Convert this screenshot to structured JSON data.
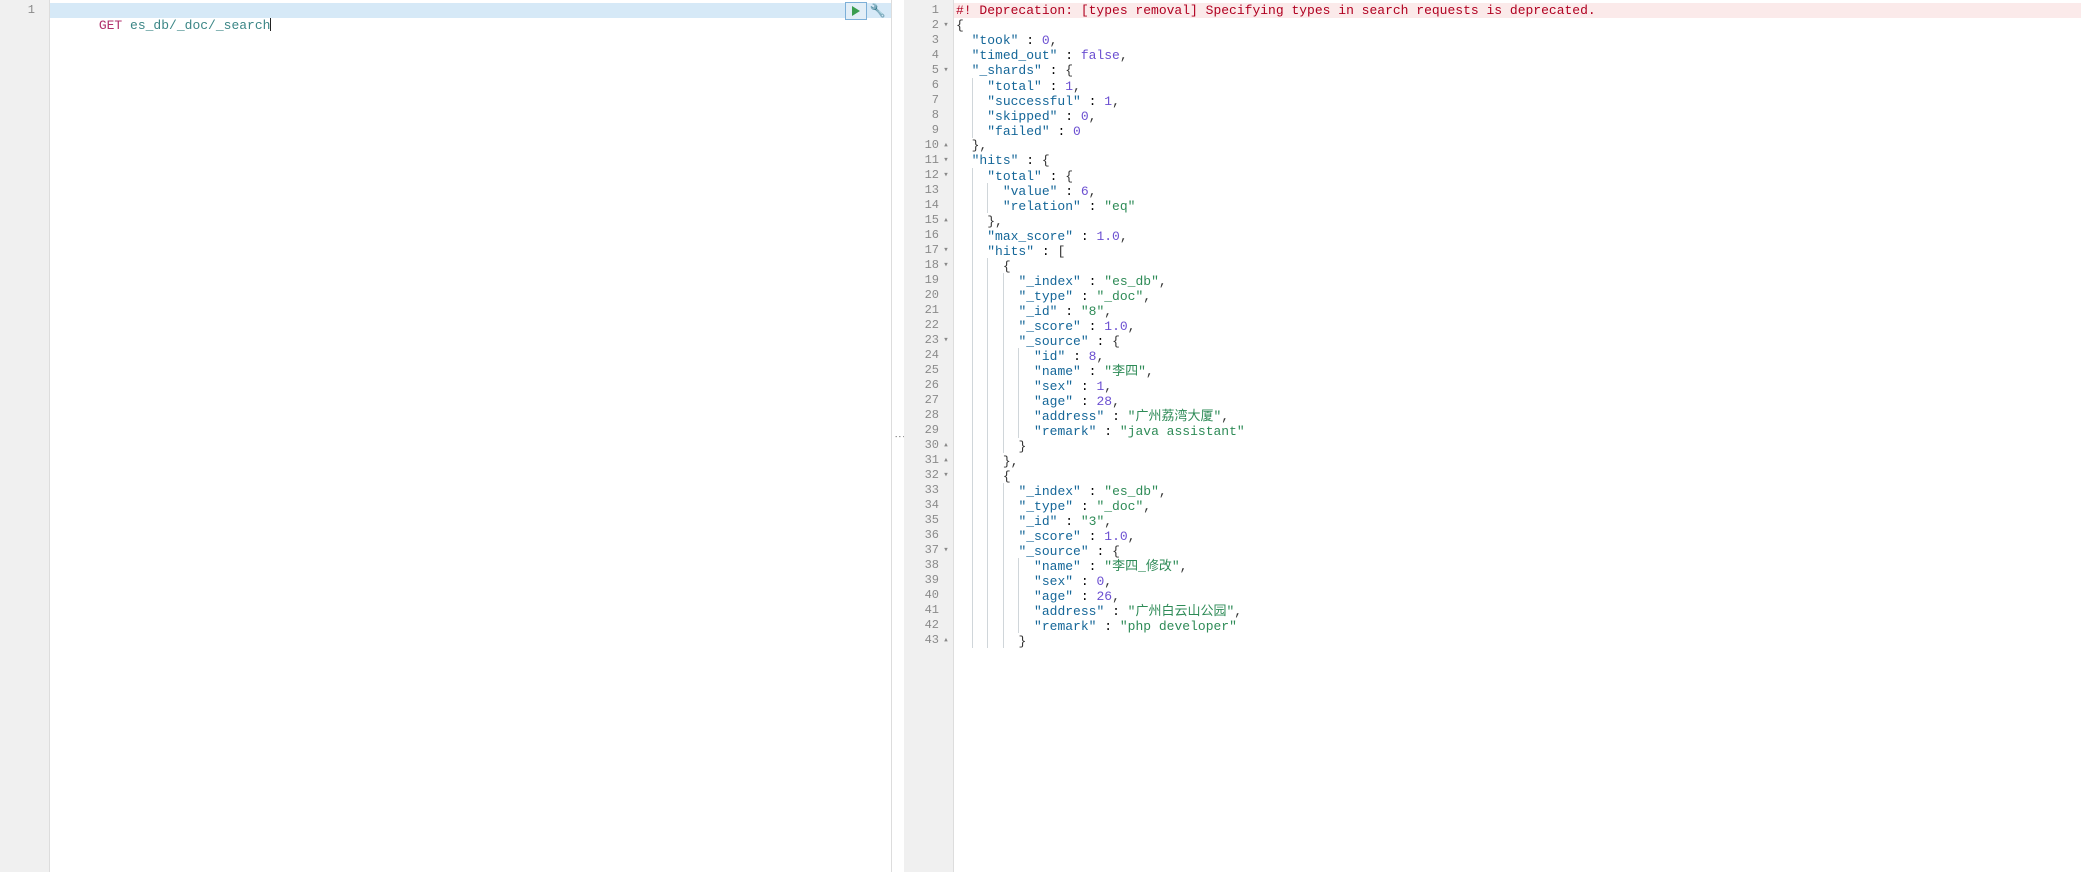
{
  "request": {
    "method": "GET",
    "path": "es_db/_doc/_search"
  },
  "deprecation": "#! Deprecation: [types removal] Specifying types in search requests is deprecated.",
  "left_gutter": [
    {
      "n": "1",
      "fold": ""
    }
  ],
  "right_lines": [
    {
      "n": "1",
      "fold": "",
      "cls": "deprec",
      "tokens": [
        {
          "t": "#! Deprecation: [types removal] Specifying types in search requests is deprecated.",
          "c": "tk-warn"
        }
      ]
    },
    {
      "n": "2",
      "fold": "▾",
      "tokens": [
        {
          "t": "{",
          "c": "tk-punc"
        }
      ]
    },
    {
      "n": "3",
      "tokens": [
        {
          "t": "  "
        },
        {
          "t": "\"took\"",
          "c": "tk-key"
        },
        {
          "t": " : "
        },
        {
          "t": "0",
          "c": "tk-num"
        },
        {
          "t": ",",
          "c": "tk-punc"
        }
      ]
    },
    {
      "n": "4",
      "tokens": [
        {
          "t": "  "
        },
        {
          "t": "\"timed_out\"",
          "c": "tk-key"
        },
        {
          "t": " : "
        },
        {
          "t": "false",
          "c": "tk-bool"
        },
        {
          "t": ",",
          "c": "tk-punc"
        }
      ]
    },
    {
      "n": "5",
      "fold": "▾",
      "tokens": [
        {
          "t": "  "
        },
        {
          "t": "\"_shards\"",
          "c": "tk-key"
        },
        {
          "t": " : "
        },
        {
          "t": "{",
          "c": "tk-punc"
        }
      ]
    },
    {
      "n": "6",
      "tokens": [
        {
          "t": "    ",
          "g": 1
        },
        {
          "t": "\"total\"",
          "c": "tk-key"
        },
        {
          "t": " : "
        },
        {
          "t": "1",
          "c": "tk-num"
        },
        {
          "t": ",",
          "c": "tk-punc"
        }
      ]
    },
    {
      "n": "7",
      "tokens": [
        {
          "t": "    ",
          "g": 1
        },
        {
          "t": "\"successful\"",
          "c": "tk-key"
        },
        {
          "t": " : "
        },
        {
          "t": "1",
          "c": "tk-num"
        },
        {
          "t": ",",
          "c": "tk-punc"
        }
      ]
    },
    {
      "n": "8",
      "tokens": [
        {
          "t": "    ",
          "g": 1
        },
        {
          "t": "\"skipped\"",
          "c": "tk-key"
        },
        {
          "t": " : "
        },
        {
          "t": "0",
          "c": "tk-num"
        },
        {
          "t": ",",
          "c": "tk-punc"
        }
      ]
    },
    {
      "n": "9",
      "tokens": [
        {
          "t": "    ",
          "g": 1
        },
        {
          "t": "\"failed\"",
          "c": "tk-key"
        },
        {
          "t": " : "
        },
        {
          "t": "0",
          "c": "tk-num"
        }
      ]
    },
    {
      "n": "10",
      "fold": "▴",
      "tokens": [
        {
          "t": "  "
        },
        {
          "t": "},",
          "c": "tk-punc"
        }
      ]
    },
    {
      "n": "11",
      "fold": "▾",
      "tokens": [
        {
          "t": "  "
        },
        {
          "t": "\"hits\"",
          "c": "tk-key"
        },
        {
          "t": " : "
        },
        {
          "t": "{",
          "c": "tk-punc"
        }
      ]
    },
    {
      "n": "12",
      "fold": "▾",
      "tokens": [
        {
          "t": "    ",
          "g": 1
        },
        {
          "t": "\"total\"",
          "c": "tk-key"
        },
        {
          "t": " : "
        },
        {
          "t": "{",
          "c": "tk-punc"
        }
      ]
    },
    {
      "n": "13",
      "tokens": [
        {
          "t": "      ",
          "g": 2
        },
        {
          "t": "\"value\"",
          "c": "tk-key"
        },
        {
          "t": " : "
        },
        {
          "t": "6",
          "c": "tk-num"
        },
        {
          "t": ",",
          "c": "tk-punc"
        }
      ]
    },
    {
      "n": "14",
      "tokens": [
        {
          "t": "      ",
          "g": 2
        },
        {
          "t": "\"relation\"",
          "c": "tk-key"
        },
        {
          "t": " : "
        },
        {
          "t": "\"eq\"",
          "c": "tk-str"
        }
      ]
    },
    {
      "n": "15",
      "fold": "▴",
      "tokens": [
        {
          "t": "    ",
          "g": 1
        },
        {
          "t": "},",
          "c": "tk-punc"
        }
      ]
    },
    {
      "n": "16",
      "tokens": [
        {
          "t": "    ",
          "g": 1
        },
        {
          "t": "\"max_score\"",
          "c": "tk-key"
        },
        {
          "t": " : "
        },
        {
          "t": "1.0",
          "c": "tk-num"
        },
        {
          "t": ",",
          "c": "tk-punc"
        }
      ]
    },
    {
      "n": "17",
      "fold": "▾",
      "tokens": [
        {
          "t": "    ",
          "g": 1
        },
        {
          "t": "\"hits\"",
          "c": "tk-key"
        },
        {
          "t": " : "
        },
        {
          "t": "[",
          "c": "tk-punc"
        }
      ]
    },
    {
      "n": "18",
      "fold": "▾",
      "tokens": [
        {
          "t": "      ",
          "g": 2
        },
        {
          "t": "{",
          "c": "tk-punc"
        }
      ]
    },
    {
      "n": "19",
      "tokens": [
        {
          "t": "        ",
          "g": 3
        },
        {
          "t": "\"_index\"",
          "c": "tk-key"
        },
        {
          "t": " : "
        },
        {
          "t": "\"es_db\"",
          "c": "tk-str"
        },
        {
          "t": ",",
          "c": "tk-punc"
        }
      ]
    },
    {
      "n": "20",
      "tokens": [
        {
          "t": "        ",
          "g": 3
        },
        {
          "t": "\"_type\"",
          "c": "tk-key"
        },
        {
          "t": " : "
        },
        {
          "t": "\"_doc\"",
          "c": "tk-str"
        },
        {
          "t": ",",
          "c": "tk-punc"
        }
      ]
    },
    {
      "n": "21",
      "tokens": [
        {
          "t": "        ",
          "g": 3
        },
        {
          "t": "\"_id\"",
          "c": "tk-key"
        },
        {
          "t": " : "
        },
        {
          "t": "\"8\"",
          "c": "tk-str"
        },
        {
          "t": ",",
          "c": "tk-punc"
        }
      ]
    },
    {
      "n": "22",
      "tokens": [
        {
          "t": "        ",
          "g": 3
        },
        {
          "t": "\"_score\"",
          "c": "tk-key"
        },
        {
          "t": " : "
        },
        {
          "t": "1.0",
          "c": "tk-num"
        },
        {
          "t": ",",
          "c": "tk-punc"
        }
      ]
    },
    {
      "n": "23",
      "fold": "▾",
      "tokens": [
        {
          "t": "        ",
          "g": 3
        },
        {
          "t": "\"_source\"",
          "c": "tk-key"
        },
        {
          "t": " : "
        },
        {
          "t": "{",
          "c": "tk-punc"
        }
      ]
    },
    {
      "n": "24",
      "tokens": [
        {
          "t": "          ",
          "g": 4
        },
        {
          "t": "\"id\"",
          "c": "tk-key"
        },
        {
          "t": " : "
        },
        {
          "t": "8",
          "c": "tk-num"
        },
        {
          "t": ",",
          "c": "tk-punc"
        }
      ]
    },
    {
      "n": "25",
      "tokens": [
        {
          "t": "          ",
          "g": 4
        },
        {
          "t": "\"name\"",
          "c": "tk-key"
        },
        {
          "t": " : "
        },
        {
          "t": "\"李四\"",
          "c": "tk-str"
        },
        {
          "t": ",",
          "c": "tk-punc"
        }
      ]
    },
    {
      "n": "26",
      "tokens": [
        {
          "t": "          ",
          "g": 4
        },
        {
          "t": "\"sex\"",
          "c": "tk-key"
        },
        {
          "t": " : "
        },
        {
          "t": "1",
          "c": "tk-num"
        },
        {
          "t": ",",
          "c": "tk-punc"
        }
      ]
    },
    {
      "n": "27",
      "tokens": [
        {
          "t": "          ",
          "g": 4
        },
        {
          "t": "\"age\"",
          "c": "tk-key"
        },
        {
          "t": " : "
        },
        {
          "t": "28",
          "c": "tk-num"
        },
        {
          "t": ",",
          "c": "tk-punc"
        }
      ]
    },
    {
      "n": "28",
      "tokens": [
        {
          "t": "          ",
          "g": 4
        },
        {
          "t": "\"address\"",
          "c": "tk-key"
        },
        {
          "t": " : "
        },
        {
          "t": "\"广州荔湾大厦\"",
          "c": "tk-str"
        },
        {
          "t": ",",
          "c": "tk-punc"
        }
      ]
    },
    {
      "n": "29",
      "tokens": [
        {
          "t": "          ",
          "g": 4
        },
        {
          "t": "\"remark\"",
          "c": "tk-key"
        },
        {
          "t": " : "
        },
        {
          "t": "\"java assistant\"",
          "c": "tk-str"
        }
      ]
    },
    {
      "n": "30",
      "fold": "▴",
      "tokens": [
        {
          "t": "        ",
          "g": 3
        },
        {
          "t": "}",
          "c": "tk-punc"
        }
      ]
    },
    {
      "n": "31",
      "fold": "▴",
      "tokens": [
        {
          "t": "      ",
          "g": 2
        },
        {
          "t": "},",
          "c": "tk-punc"
        }
      ]
    },
    {
      "n": "32",
      "fold": "▾",
      "tokens": [
        {
          "t": "      ",
          "g": 2
        },
        {
          "t": "{",
          "c": "tk-punc"
        }
      ]
    },
    {
      "n": "33",
      "tokens": [
        {
          "t": "        ",
          "g": 3
        },
        {
          "t": "\"_index\"",
          "c": "tk-key"
        },
        {
          "t": " : "
        },
        {
          "t": "\"es_db\"",
          "c": "tk-str"
        },
        {
          "t": ",",
          "c": "tk-punc"
        }
      ]
    },
    {
      "n": "34",
      "tokens": [
        {
          "t": "        ",
          "g": 3
        },
        {
          "t": "\"_type\"",
          "c": "tk-key"
        },
        {
          "t": " : "
        },
        {
          "t": "\"_doc\"",
          "c": "tk-str"
        },
        {
          "t": ",",
          "c": "tk-punc"
        }
      ]
    },
    {
      "n": "35",
      "tokens": [
        {
          "t": "        ",
          "g": 3
        },
        {
          "t": "\"_id\"",
          "c": "tk-key"
        },
        {
          "t": " : "
        },
        {
          "t": "\"3\"",
          "c": "tk-str"
        },
        {
          "t": ",",
          "c": "tk-punc"
        }
      ]
    },
    {
      "n": "36",
      "tokens": [
        {
          "t": "        ",
          "g": 3
        },
        {
          "t": "\"_score\"",
          "c": "tk-key"
        },
        {
          "t": " : "
        },
        {
          "t": "1.0",
          "c": "tk-num"
        },
        {
          "t": ",",
          "c": "tk-punc"
        }
      ]
    },
    {
      "n": "37",
      "fold": "▾",
      "tokens": [
        {
          "t": "        ",
          "g": 3
        },
        {
          "t": "\"_source\"",
          "c": "tk-key"
        },
        {
          "t": " : "
        },
        {
          "t": "{",
          "c": "tk-punc"
        }
      ]
    },
    {
      "n": "38",
      "tokens": [
        {
          "t": "          ",
          "g": 4
        },
        {
          "t": "\"name\"",
          "c": "tk-key"
        },
        {
          "t": " : "
        },
        {
          "t": "\"李四_修改\"",
          "c": "tk-str"
        },
        {
          "t": ",",
          "c": "tk-punc"
        }
      ]
    },
    {
      "n": "39",
      "tokens": [
        {
          "t": "          ",
          "g": 4
        },
        {
          "t": "\"sex\"",
          "c": "tk-key"
        },
        {
          "t": " : "
        },
        {
          "t": "0",
          "c": "tk-num"
        },
        {
          "t": ",",
          "c": "tk-punc"
        }
      ]
    },
    {
      "n": "40",
      "tokens": [
        {
          "t": "          ",
          "g": 4
        },
        {
          "t": "\"age\"",
          "c": "tk-key"
        },
        {
          "t": " : "
        },
        {
          "t": "26",
          "c": "tk-num"
        },
        {
          "t": ",",
          "c": "tk-punc"
        }
      ]
    },
    {
      "n": "41",
      "tokens": [
        {
          "t": "          ",
          "g": 4
        },
        {
          "t": "\"address\"",
          "c": "tk-key"
        },
        {
          "t": " : "
        },
        {
          "t": "\"广州白云山公园\"",
          "c": "tk-str"
        },
        {
          "t": ",",
          "c": "tk-punc"
        }
      ]
    },
    {
      "n": "42",
      "tokens": [
        {
          "t": "          ",
          "g": 4
        },
        {
          "t": "\"remark\"",
          "c": "tk-key"
        },
        {
          "t": " : "
        },
        {
          "t": "\"php developer\"",
          "c": "tk-str"
        }
      ]
    },
    {
      "n": "43",
      "fold": "▴",
      "tokens": [
        {
          "t": "        ",
          "g": 3
        },
        {
          "t": "}",
          "c": "tk-punc"
        }
      ]
    }
  ]
}
